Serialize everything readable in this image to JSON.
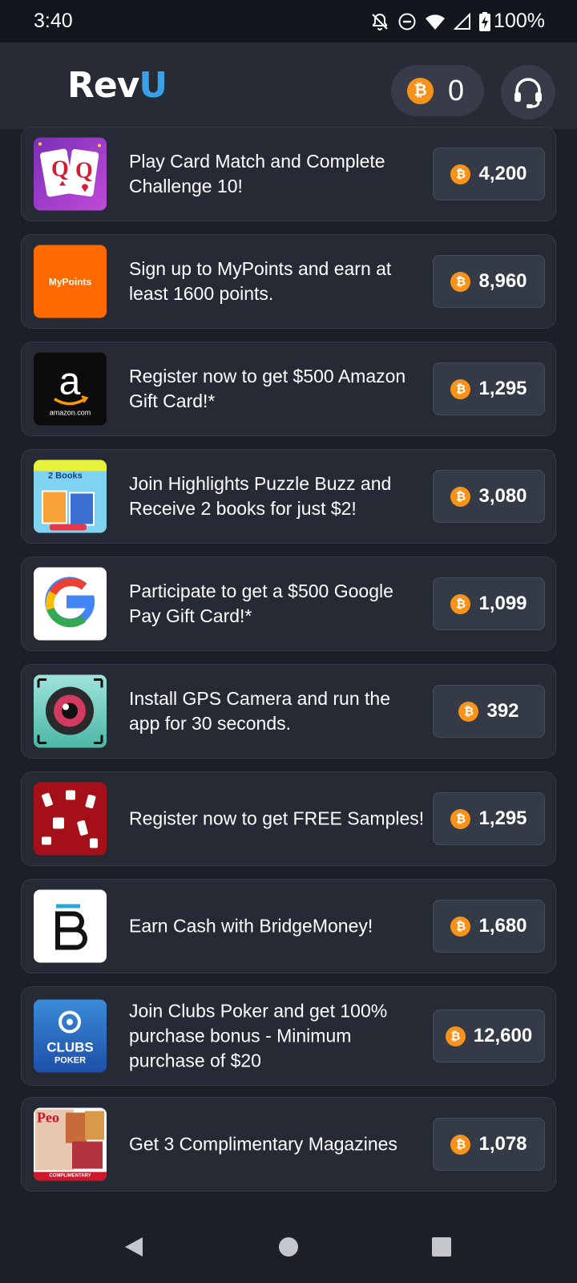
{
  "status_bar": {
    "time": "3:40",
    "battery": "100%",
    "icons": [
      "bell-off-icon",
      "do-not-disturb-icon",
      "wifi-icon",
      "signal-icon",
      "battery-charging-icon"
    ]
  },
  "header": {
    "logo_main": "Rev",
    "logo_accent": "U",
    "coin_balance": "0",
    "coin_symbol": "₿",
    "support_icon": "headset-icon"
  },
  "offers": [
    {
      "title": "Play Card Match and Complete Challenge 10!",
      "reward": "4,200",
      "icon": "card-match-icon"
    },
    {
      "title": "Sign up to MyPoints and earn at least 1600 points.",
      "reward": "8,960",
      "icon": "mypoints-icon",
      "icon_text": "MyPoints"
    },
    {
      "title": "Register now to get $500 Amazon Gift Card!*",
      "reward": "1,295",
      "icon": "amazon-icon",
      "icon_text": "amazon.com"
    },
    {
      "title": "Join Highlights Puzzle Buzz and Receive 2 books for just $2!",
      "reward": "3,080",
      "icon": "puzzle-buzz-icon",
      "icon_text": "2 Books"
    },
    {
      "title": "Participate to get a $500 Google Pay Gift Card!*",
      "reward": "1,099",
      "icon": "google-icon"
    },
    {
      "title": "Install GPS Camera and run the app for 30 seconds.",
      "reward": "392",
      "icon": "gps-camera-icon"
    },
    {
      "title": "Register now to get FREE Samples!",
      "reward": "1,295",
      "icon": "free-samples-icon"
    },
    {
      "title": "Earn Cash with BridgeMoney!",
      "reward": "1,680",
      "icon": "bridgemoney-icon"
    },
    {
      "title": "Join Clubs Poker and get 100% purchase bonus - Minimum purchase of $20",
      "reward": "12,600",
      "icon": "clubs-poker-icon",
      "icon_text": "CLUBS",
      "icon_subtext": "POKER"
    },
    {
      "title": "Get 3 Complimentary Magazines",
      "reward": "1,078",
      "icon": "magazines-icon",
      "icon_text": "COMPLIMENTARY"
    }
  ],
  "nav": {
    "back_icon": "back-icon",
    "home_icon": "home-icon",
    "recents_icon": "recents-icon"
  },
  "colors": {
    "background": "#1b1f28",
    "card": "#262a35",
    "coin": "#f7931a",
    "accent": "#3aa1e8"
  }
}
